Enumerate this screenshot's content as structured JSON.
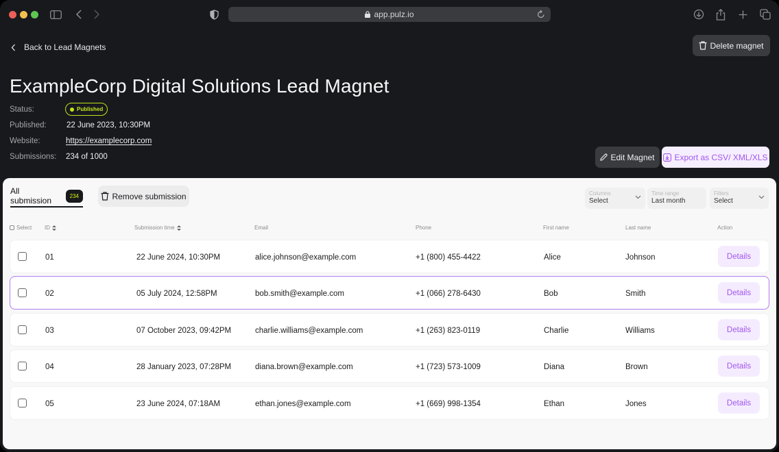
{
  "browser": {
    "url": "app.pulz.io",
    "icons": [
      "sidebar-icon",
      "back-arrow-icon",
      "forward-arrow-icon",
      "shield-icon",
      "lock-icon",
      "reload-icon",
      "download-icon",
      "share-icon",
      "new-tab-icon",
      "tabs-overview-icon"
    ]
  },
  "header": {
    "back_label": "Back to Lead Magnets",
    "delete_label": "Delete magnet",
    "title": "ExampleCorp Digital Solutions Lead Magnet",
    "meta": {
      "status_label": "Status:",
      "status_value": "Published",
      "published_label": "Published:",
      "published_value": "22 June 2023, 10:30PM",
      "website_label": "Website:",
      "website_value": "https://examplecorp.com",
      "submissions_label": "Submissions:",
      "submissions_value": "234 of 1000"
    },
    "edit_label": "Edit Magnet",
    "export_label": "Export as CSV/ XML/XLS"
  },
  "colors": {
    "background": "#18191d",
    "status_published": "#c3e21d",
    "accent_purple": "#a255ee",
    "accent_purple_bg": "#f4ecfe"
  },
  "panel": {
    "tab_label": "All submission",
    "tab_count": "234",
    "remove_label": "Remove submission",
    "filters": [
      {
        "label": "Columns",
        "value": "Select"
      },
      {
        "label": "Time range",
        "value": "Last month"
      },
      {
        "label": "Filters",
        "value": "Select"
      }
    ],
    "columns": {
      "select": "Select",
      "id": "ID",
      "time": "Submission time",
      "email": "Email",
      "phone": "Phone",
      "first": "First name",
      "last": "Last name",
      "action": "Action"
    },
    "action_label": "Details",
    "rows": [
      {
        "id": "01",
        "time": "22 June 2024, 10:30PM",
        "email": "alice.johnson@example.com",
        "phone": "+1 (800) 455-4422",
        "first": "Alice",
        "last": "Johnson",
        "selected": false
      },
      {
        "id": "02",
        "time": "05 July 2024, 12:58PM",
        "email": "bob.smith@example.com",
        "phone": "+1 (066) 278-6430",
        "first": "Bob",
        "last": "Smith",
        "selected": false,
        "highlighted": true
      },
      {
        "id": "03",
        "time": "07 October 2023, 09:42PM",
        "email": "charlie.williams@example.com",
        "phone": "+1 (263) 823-0119",
        "first": "Charlie",
        "last": "Williams",
        "selected": false
      },
      {
        "id": "04",
        "time": "28 January 2023, 07:28PM",
        "email": "diana.brown@example.com",
        "phone": "+1 (723) 573-1009",
        "first": "Diana",
        "last": "Brown",
        "selected": false
      },
      {
        "id": "05",
        "time": "23 June 2024, 07:18AM",
        "email": "ethan.jones@example.com",
        "phone": "+1 (669) 998-1354",
        "first": "Ethan",
        "last": "Jones",
        "selected": false
      }
    ]
  }
}
